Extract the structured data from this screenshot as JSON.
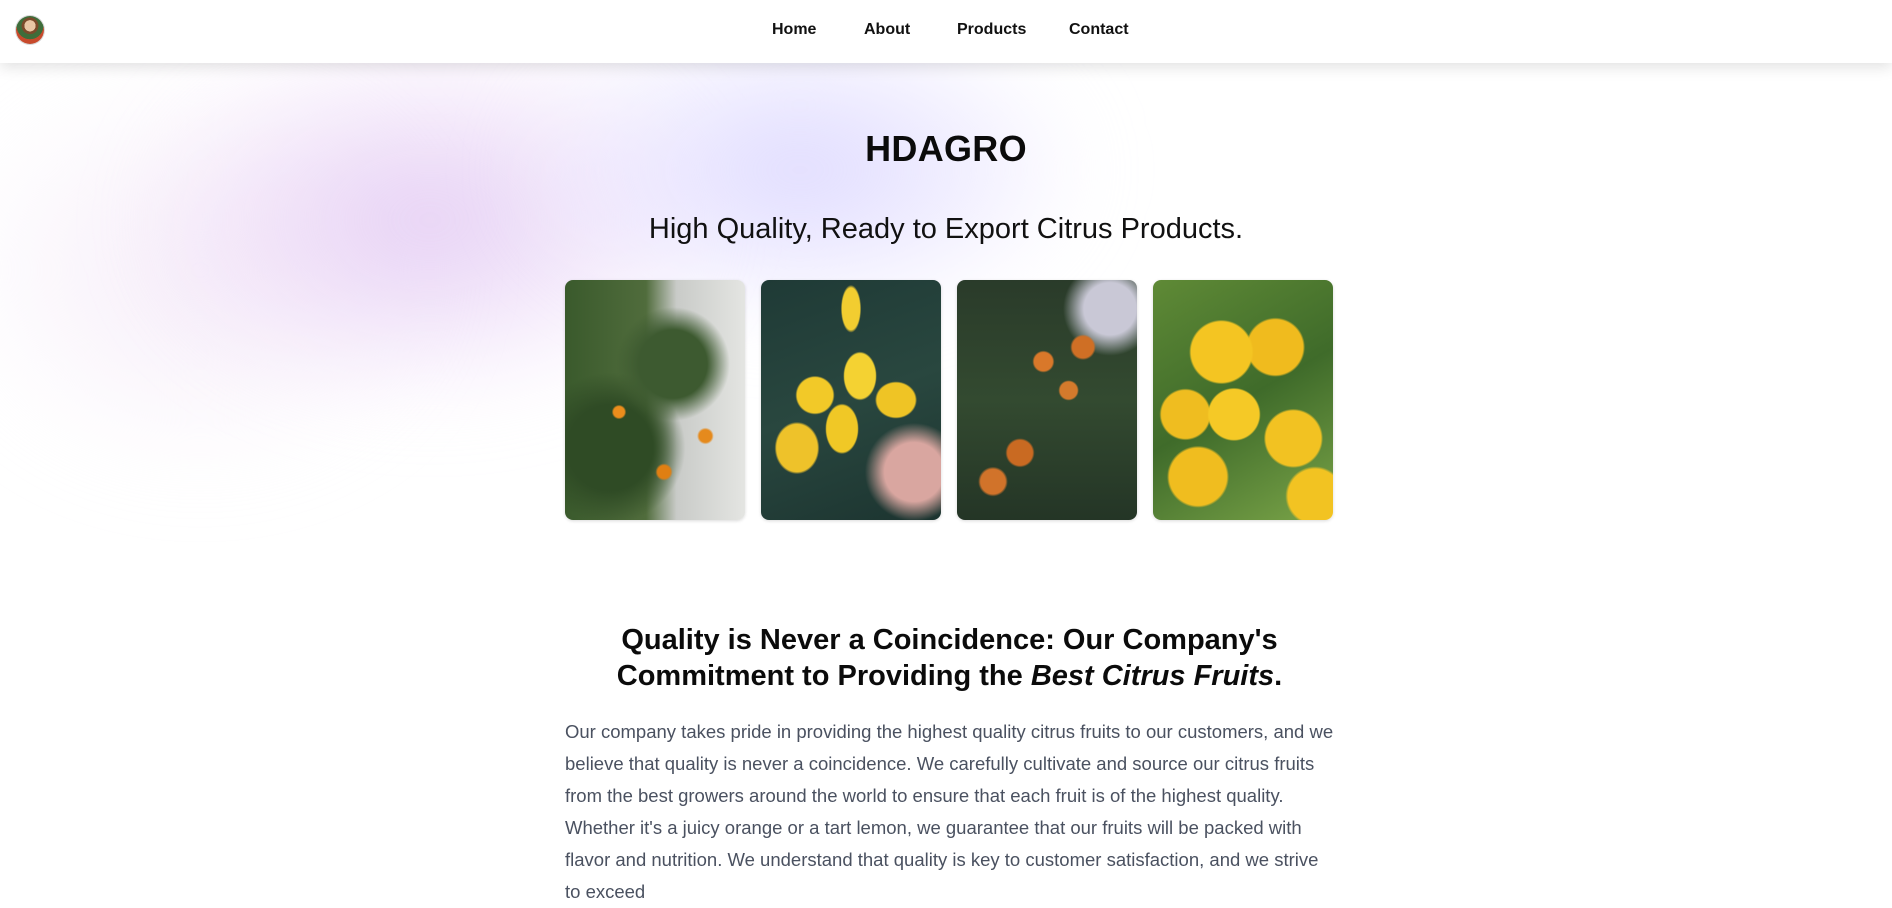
{
  "nav": {
    "logo_alt": "HDAGRO logo",
    "links": [
      {
        "label": "Home"
      },
      {
        "label": "About"
      },
      {
        "label": "Products"
      },
      {
        "label": "Contact"
      }
    ]
  },
  "hero": {
    "title": "HDAGRO",
    "subtitle": "High Quality, Ready to Export Citrus Products."
  },
  "gallery": {
    "images": [
      {
        "alt": "Orange tree branches"
      },
      {
        "alt": "Lemons on tree"
      },
      {
        "alt": "Oranges among leaves"
      },
      {
        "alt": "Yellow citrus cluster"
      }
    ]
  },
  "quality_section": {
    "heading_prefix": "Quality is Never a Coincidence: Our Company's Commitment to Providing the ",
    "heading_emphasis": "Best Citrus Fruits",
    "heading_suffix": ".",
    "body": "Our company takes pride in providing the highest quality citrus fruits to our customers, and we believe that quality is never a coincidence. We carefully cultivate and source our citrus fruits from the best growers around the world to ensure that each fruit is of the highest quality. Whether it's a juicy orange or a tart lemon, we guarantee that our fruits will be packed with flavor and nutrition. We understand that quality is key to customer satisfaction, and we strive to exceed"
  },
  "colors": {
    "nav_bg": "#ffffff",
    "text_primary": "#111111",
    "text_body": "#4a5160",
    "glow_purple": "#dcbef0",
    "glow_lavender": "#d7d2ff"
  }
}
